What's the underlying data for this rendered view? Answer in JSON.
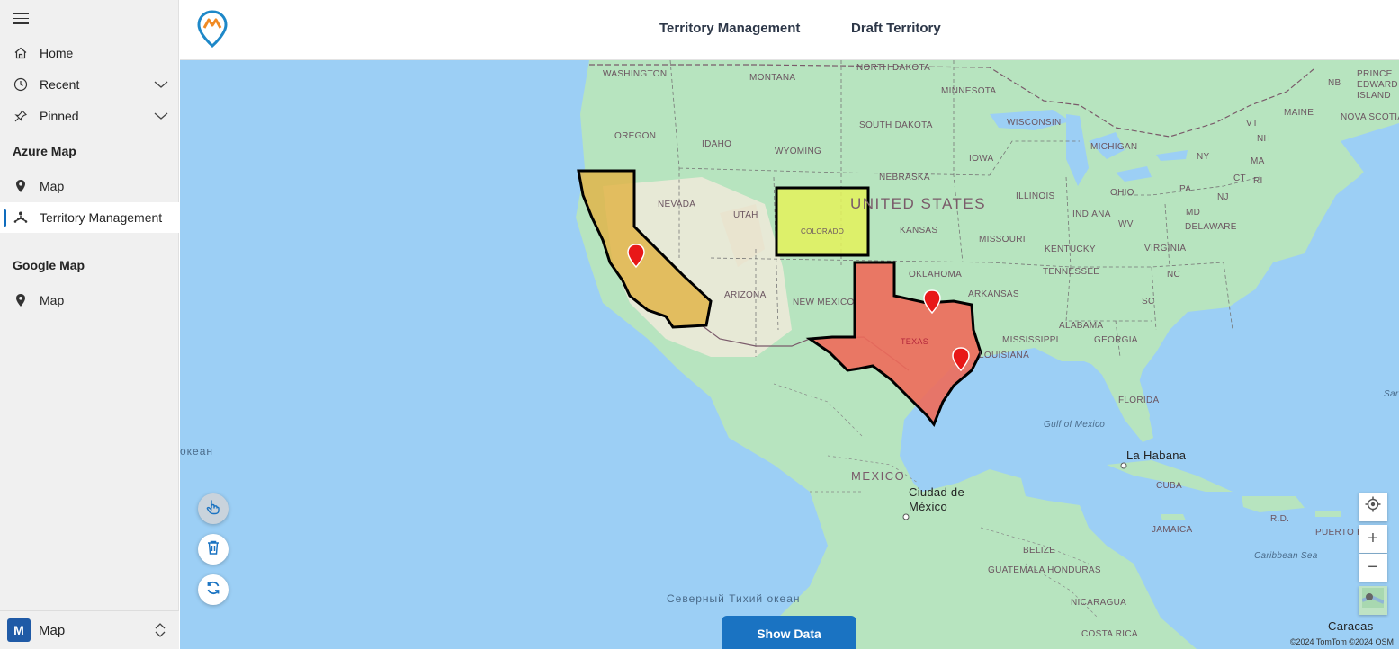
{
  "sidebar": {
    "items": [
      {
        "label": "Home",
        "icon": "home-icon"
      },
      {
        "label": "Recent",
        "icon": "clock-icon"
      },
      {
        "label": "Pinned",
        "icon": "pin-icon"
      }
    ],
    "groups": [
      {
        "label": "Azure Map",
        "items": [
          {
            "label": "Map"
          },
          {
            "label": "Territory Management"
          }
        ]
      },
      {
        "label": "Google Map",
        "items": [
          {
            "label": "Map"
          }
        ]
      }
    ],
    "area": {
      "badge": "M",
      "label": "Map"
    }
  },
  "header": {
    "tabs": [
      "Territory Management",
      "Draft Territory"
    ]
  },
  "map": {
    "country_label": "UNITED STATES",
    "states": [
      "WASHINGTON",
      "MONTANA",
      "NORTH DAKOTA",
      "MINNESOTA",
      "OREGON",
      "IDAHO",
      "SOUTH DAKOTA",
      "WISCONSIN",
      "MICHIGAN",
      "WYOMING",
      "IOWA",
      "NEBRASKA",
      "NEVADA",
      "UTAH",
      "COLORADO",
      "KANSAS",
      "ILLINOIS",
      "INDIANA",
      "OHIO",
      "PA",
      "NY",
      "MISSOURI",
      "KENTUCKY",
      "WV",
      "VIRGINIA",
      "MAINE",
      "VT",
      "NH",
      "MA",
      "CT",
      "RI",
      "NJ",
      "MD",
      "DELAWARE",
      "TENNESSEE",
      "NC",
      "SC",
      "ARIZONA",
      "NEW MEXICO",
      "OKLAHOMA",
      "ARKANSAS",
      "ALABAMA",
      "GEORGIA",
      "MISSISSIPPI",
      "LOUISIANA",
      "TEXAS",
      "FLORIDA",
      "MEXICO",
      "CUBA",
      "JAMAICA",
      "BELIZE",
      "GUATEMALA HONDURAS",
      "NICARAGUA",
      "COSTA RICA",
      "R.D.",
      "PUERTO RICO",
      "PRINCE EDWARD ISLAND",
      "NB",
      "NOVA SCOTIA"
    ],
    "cities": [
      "La Habana",
      "Ciudad de México",
      "Caracas"
    ],
    "water": [
      "Gulf of Mexico",
      "Caribbean Sea",
      "Северный Тихий океан",
      "океан",
      "Sar"
    ],
    "attribution": "©2024 TomTom ©2024 OSM",
    "territory_colors": {
      "california": "#e0b54a",
      "colorado": "#e4f25a",
      "texas": "#ee6a5a"
    },
    "show_data_label": "Show Data"
  }
}
